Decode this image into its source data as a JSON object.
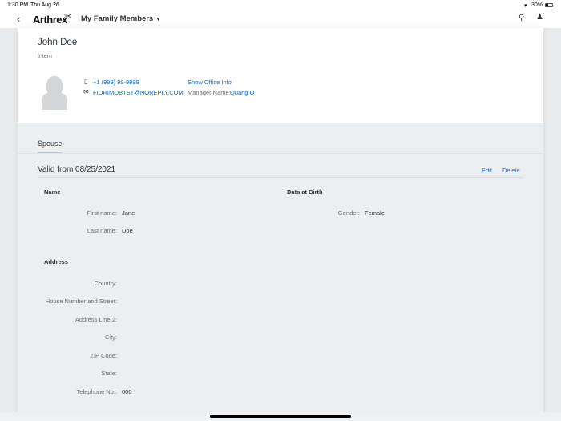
{
  "status_bar": {
    "time": "1:30 PM",
    "date": "Thu Aug 26",
    "battery": "30%"
  },
  "nav": {
    "logo": "Arthrex",
    "title": "My Family Members"
  },
  "profile": {
    "name": "John Doe",
    "role": "Intern",
    "phone": "+1 (999) 99-9999",
    "email": "FIORIMOBTST@NOREPLY.COM",
    "office_link": "Show Office Info",
    "manager_label": "Manager Name:",
    "manager": "Quang O"
  },
  "tabs": [
    {
      "label": "Spouse",
      "selected": true
    }
  ],
  "record": {
    "title": "Valid from 08/25/2021",
    "edit": "Edit",
    "delete": "Delete"
  },
  "name_section": {
    "heading": "Name",
    "fields": [
      {
        "label": "First name:",
        "value": "Jane"
      },
      {
        "label": "Last name:",
        "value": "Doe"
      }
    ]
  },
  "birth_section": {
    "heading": "Data at Birth",
    "fields": [
      {
        "label": "Gender:",
        "value": "Female"
      }
    ]
  },
  "address_section": {
    "heading": "Address",
    "fields": [
      {
        "label": "Country:",
        "value": ""
      },
      {
        "label": "House Number and Street:",
        "value": ""
      },
      {
        "label": "Address Line 2:",
        "value": ""
      },
      {
        "label": "City:",
        "value": ""
      },
      {
        "label": "ZIP Code:",
        "value": ""
      },
      {
        "label": "State:",
        "value": ""
      },
      {
        "label": "Telephone No.:",
        "value": "000"
      }
    ]
  }
}
